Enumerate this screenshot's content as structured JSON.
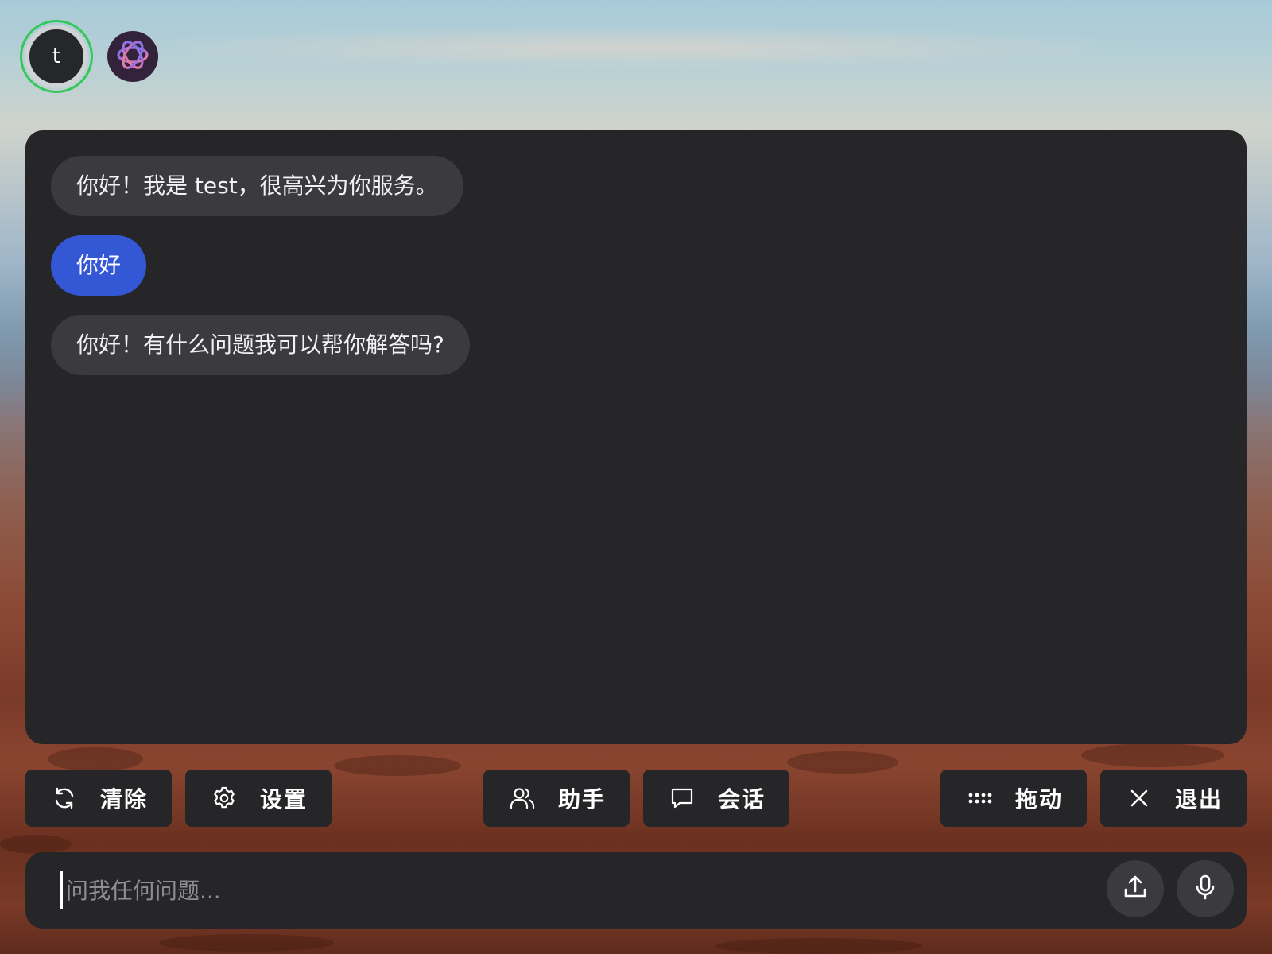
{
  "header": {
    "user_avatar_letter": "t",
    "assistant_avatar_icon": "openai-logo-icon"
  },
  "messages": [
    {
      "role": "assistant",
      "text": "你好！我是 test，很高兴为你服务。"
    },
    {
      "role": "user",
      "text": "你好"
    },
    {
      "role": "assistant",
      "text": "你好！有什么问题我可以帮你解答吗?"
    }
  ],
  "toolbar": {
    "clear": {
      "label": "清除",
      "icon": "refresh-icon"
    },
    "settings": {
      "label": "设置",
      "icon": "gear-icon"
    },
    "assistant": {
      "label": "助手",
      "icon": "users-icon"
    },
    "conversation": {
      "label": "会话",
      "icon": "chat-bubble-icon"
    },
    "drag": {
      "label": "拖动",
      "icon": "drag-dots-icon"
    },
    "exit": {
      "label": "退出",
      "icon": "close-icon"
    }
  },
  "input": {
    "placeholder": "问我任何问题...",
    "value": ""
  },
  "input_actions": {
    "upload_icon": "upload-icon",
    "mic_icon": "microphone-icon"
  },
  "colors": {
    "panel_bg": "#262629",
    "assistant_bubble": "#3a3a3f",
    "user_bubble": "#3457d5",
    "online_ring": "#34c759"
  }
}
